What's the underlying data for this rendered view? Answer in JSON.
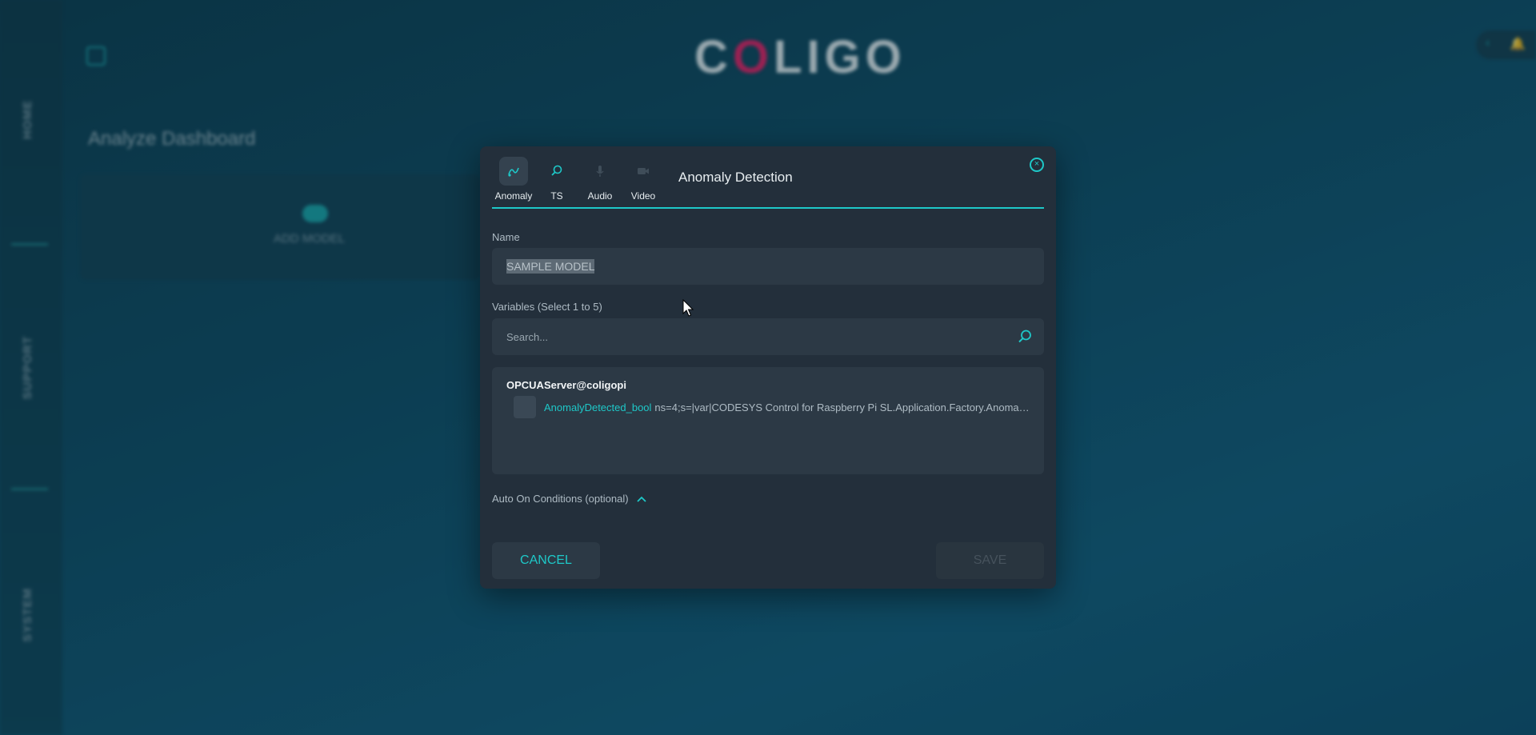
{
  "background": {
    "logo": {
      "text_before": "C",
      "text_accent": "O",
      "text_after": "LIGO"
    },
    "dashboard_title": "Analyze Dashboard",
    "add_model_label": "ADD MODEL",
    "nav": [
      {
        "label": "HOME"
      },
      {
        "label": "SUPPORT"
      },
      {
        "label": "SYSTEM"
      }
    ]
  },
  "modal": {
    "title": "Anomaly Detection",
    "tabs": [
      {
        "label": "Anomaly",
        "icon": "anomaly-icon",
        "active": true
      },
      {
        "label": "TS",
        "icon": "magnifier-icon",
        "active": false
      },
      {
        "label": "Audio",
        "icon": "microphone-icon",
        "active": false
      },
      {
        "label": "Video",
        "icon": "video-camera-icon",
        "active": false
      }
    ],
    "name_label": "Name",
    "name_value": "SAMPLE MODEL",
    "variables_label": "Variables (Select 1 to 5)",
    "search_placeholder": "Search...",
    "server_name": "OPCUAServer@coligopi",
    "variables": [
      {
        "name": "AnomalyDetected_bool",
        "path": "ns=4;s=|var|CODESYS Control for Raspberry Pi SL.Application.Factory.AnomalyDete...",
        "checked": false
      }
    ],
    "auto_on_label": "Auto On Conditions (optional)",
    "cancel_label": "CANCEL",
    "save_label": "SAVE"
  },
  "colors": {
    "accent": "#1ec8c8",
    "modal_bg": "#232f3b",
    "field_bg": "#2c3945",
    "logo_accent": "#e91e63"
  }
}
